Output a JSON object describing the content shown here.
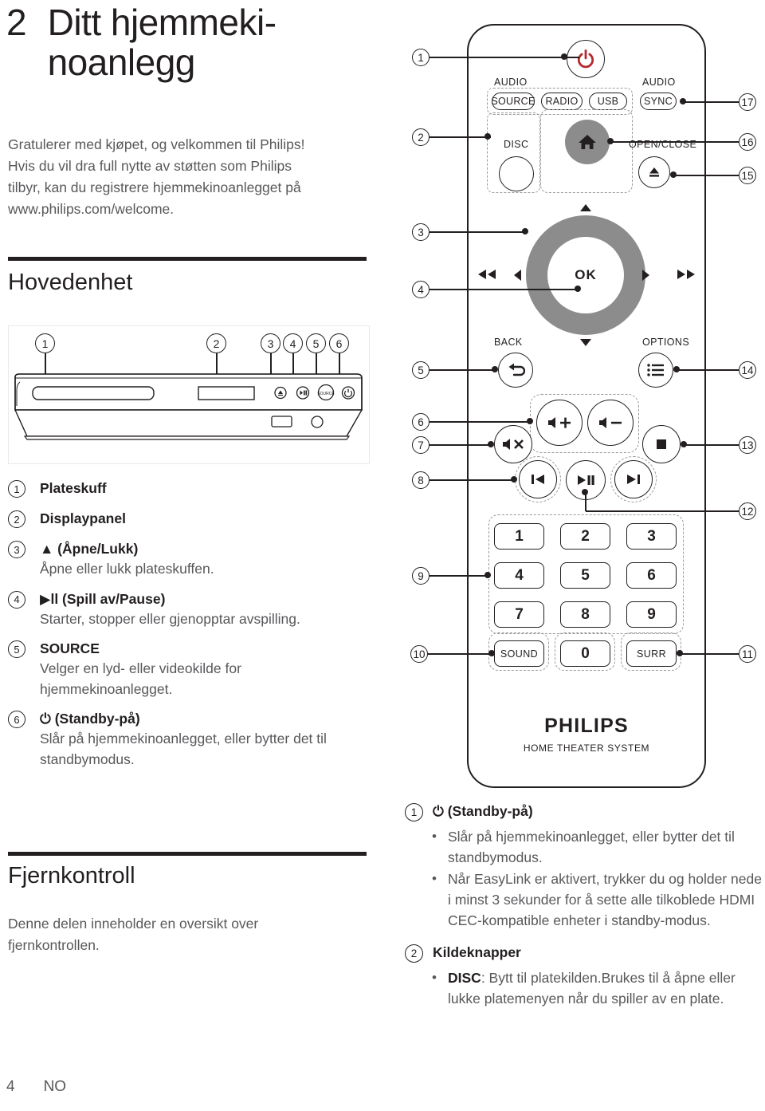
{
  "chapter": {
    "number": "2",
    "title": "Ditt hjemmeki-\nnoanlegg"
  },
  "intro": "Gratulerer med kjøpet, og velkommen til Philips! Hvis du vil dra full nytte av støtten som Philips tilbyr, kan du registrere hjemmekinoanlegget på www.philips.com/welcome.",
  "sections": {
    "main_unit_heading": "Hovedenhet",
    "remote_heading": "Fjernkontroll",
    "remote_intro": "Denne delen inneholder en oversikt over fjernkontrollen."
  },
  "main_unit_diagram": {
    "callouts": [
      "1",
      "2",
      "3",
      "4",
      "5",
      "6"
    ],
    "button_icons": [
      "eject-icon",
      "play-pause-icon",
      "source-icon",
      "standby-icon"
    ]
  },
  "main_unit_list": [
    {
      "num": "1",
      "title": "Plateskuff",
      "desc": ""
    },
    {
      "num": "2",
      "title": "Displaypanel",
      "desc": ""
    },
    {
      "num": "3",
      "title": "▲ (Åpne/Lukk)",
      "desc": "Åpne eller lukk plateskuffen."
    },
    {
      "num": "4",
      "title": "▶ll (Spill av/Pause)",
      "desc": "Starter, stopper eller gjenopptar avspilling."
    },
    {
      "num": "5",
      "title": "SOURCE",
      "desc": "Velger en lyd- eller videokilde for hjemmekinoanlegget."
    },
    {
      "num": "6",
      "title": "⏻ (Standby-på)",
      "desc": "Slår på hjemmekinoanlegget, eller bytter det til standbymodus."
    }
  ],
  "remote": {
    "brand": "PHILIPS",
    "brand_sub": "HOME THEATER SYSTEM",
    "power_icon": "standby-power-icon",
    "power_color": "#b52a2f",
    "labels": {
      "audio_left": "AUDIO",
      "audio_right": "AUDIO",
      "source": "SOURCE",
      "radio": "RADIO",
      "usb": "USB",
      "sync": "SYNC",
      "disc": "DISC",
      "open_close": "OPEN/CLOSE",
      "ok": "OK",
      "back": "BACK",
      "options": "OPTIONS",
      "sound": "SOUND",
      "surr": "SURR",
      "zero": "0"
    },
    "numeric_keys": [
      "1",
      "2",
      "3",
      "4",
      "5",
      "6",
      "7",
      "8",
      "9"
    ],
    "icons": {
      "home": "home-icon",
      "eject": "eject-icon",
      "rewind": "rewind-icon",
      "forward": "fast-forward-icon",
      "nav_up": "arrow-up-icon",
      "nav_down": "arrow-down-icon",
      "nav_left": "arrow-left-icon",
      "nav_right": "arrow-right-icon",
      "back": "back-arrow-icon",
      "options": "list-options-icon",
      "vol_up": "volume-up-icon",
      "vol_down": "volume-down-icon",
      "mute": "mute-icon",
      "stop": "stop-icon",
      "prev": "previous-track-icon",
      "play_pause": "play-pause-icon",
      "next": "next-track-icon"
    },
    "callouts_left": [
      "1",
      "2",
      "3",
      "4",
      "5",
      "6",
      "7",
      "8",
      "9",
      "10"
    ],
    "callouts_right": [
      "17",
      "16",
      "15",
      "14",
      "13",
      "12",
      "11"
    ]
  },
  "remote_list": [
    {
      "num": "1",
      "title": "⏻ (Standby-på)",
      "bullets": [
        {
          "lead": "",
          "text": "Slår på hjemmekinoanlegget, eller bytter det til standbymodus."
        },
        {
          "lead": "",
          "text": "Når EasyLink er aktivert, trykker du og holder nede i minst 3 sekunder for å sette alle tilkoblede HDMI CEC-kompatible enheter i standby-modus."
        }
      ]
    },
    {
      "num": "2",
      "title": "Kildeknapper",
      "bullets": [
        {
          "lead": "DISC",
          "text": ": Bytt til platekilden.Brukes til å åpne eller lukke platemenyen når du spiller av en plate."
        }
      ]
    }
  ],
  "footer": {
    "page": "4",
    "lang": "NO"
  }
}
